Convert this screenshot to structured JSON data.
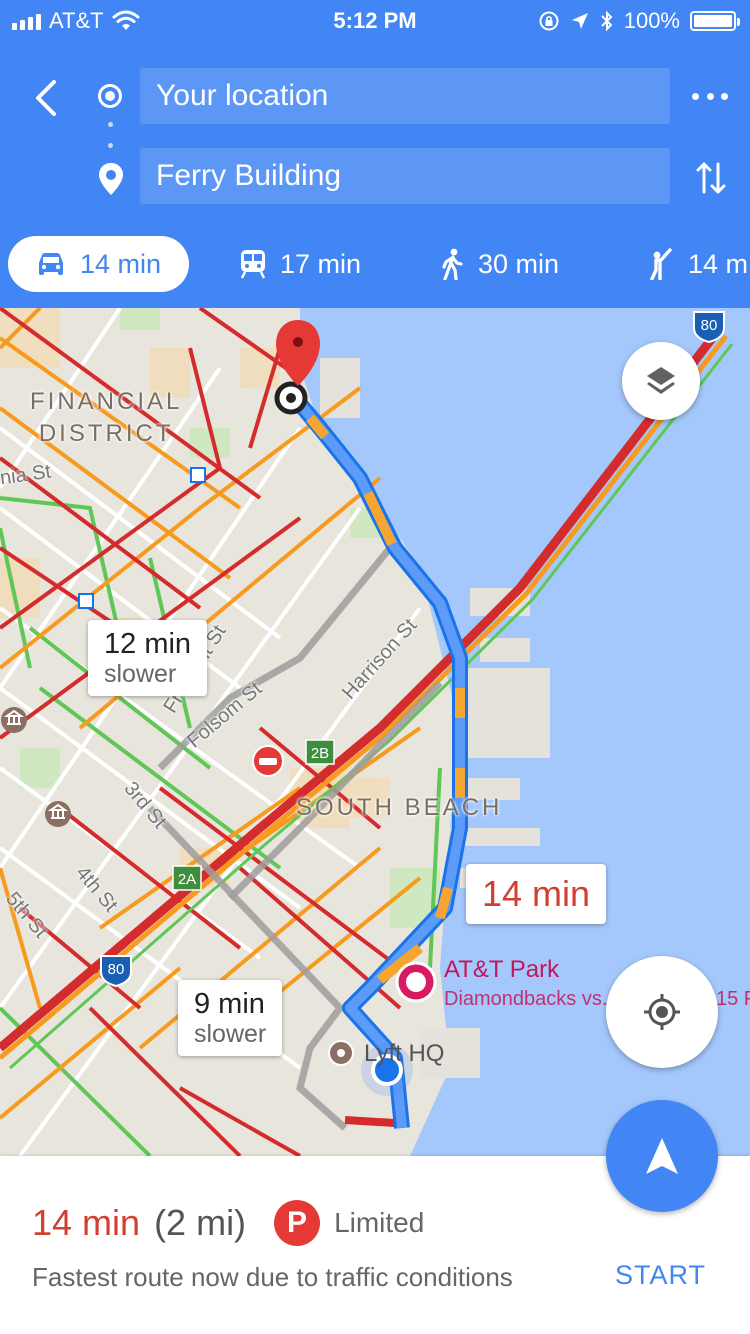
{
  "status_bar": {
    "carrier": "AT&T",
    "time": "5:12 PM",
    "battery": "100%",
    "battery_level": 1.0
  },
  "directions": {
    "origin": "Your location",
    "destination": "Ferry Building"
  },
  "modes": [
    {
      "mode": "drive",
      "icon": "car-icon",
      "time": "14 min",
      "selected": true
    },
    {
      "mode": "transit",
      "icon": "train-icon",
      "time": "17 min",
      "selected": false
    },
    {
      "mode": "walk",
      "icon": "walking-icon",
      "time": "30 min",
      "selected": false
    },
    {
      "mode": "ride",
      "icon": "ride-hailing-icon",
      "time": "14 m",
      "selected": false
    }
  ],
  "map": {
    "districts": [
      {
        "name": "FINANCIAL\nDISTRICT"
      },
      {
        "name": "SOUTH BEACH"
      }
    ],
    "streets": [
      "nia St",
      "Fremont St",
      "Folsom St",
      "Harrison St",
      "3rd St",
      "4th St",
      "5th St"
    ],
    "highway_shields": [
      "80",
      "80",
      "2B",
      "2A"
    ],
    "callouts": [
      {
        "time": "12 min",
        "note": "slower"
      },
      {
        "time": "9 min",
        "note": "slower"
      },
      {
        "time": "14 min"
      }
    ],
    "places": {
      "park_name": "AT&T Park",
      "park_event": "Diamondbacks vs...",
      "park_event_tail": "15 P",
      "lyft": "Lyft HQ"
    },
    "colors": {
      "route": "#4285f4",
      "water": "#a4c8fb",
      "traffic_heavy": "#d42c2c",
      "traffic_medium": "#f79a1e",
      "traffic_light": "#5ec756"
    }
  },
  "summary": {
    "eta": "14 min",
    "distance": "(2 mi)",
    "parking_icon": "P",
    "parking": "Limited",
    "description": "Fastest route now due to traffic conditions",
    "start": "START"
  }
}
